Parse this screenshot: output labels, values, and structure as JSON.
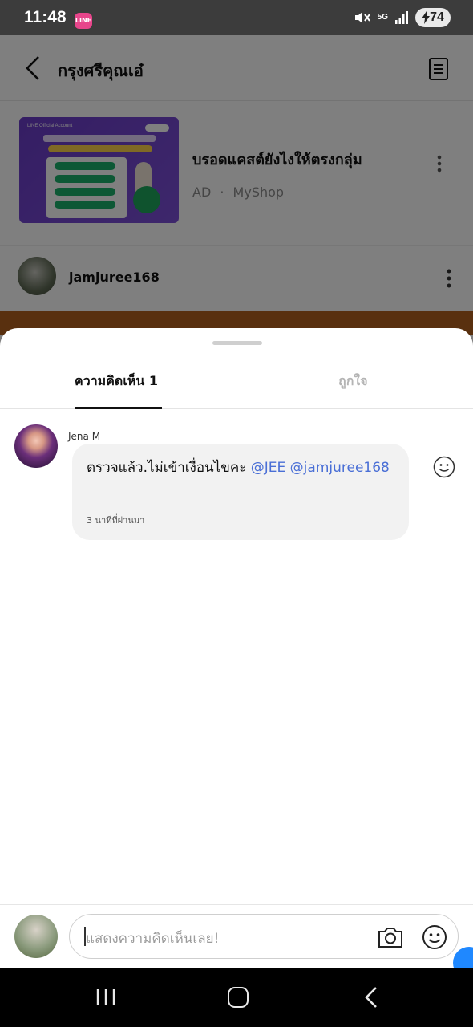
{
  "status_bar": {
    "time": "11:48",
    "app_icon_label": "LINE",
    "network": "5G",
    "battery": "74"
  },
  "header": {
    "title": "กรุงศรีคุณเอ๋"
  },
  "ad": {
    "title": "บรอดแคสต์ยังไงให้ตรงกลุ่ม",
    "tag": "AD",
    "separator": "·",
    "advertiser": "MyShop",
    "thumbnail_brand": "LINE Official Account"
  },
  "post": {
    "username": "jamjuree168"
  },
  "sheet": {
    "tabs": [
      {
        "label": "ความคิดเห็น 1",
        "active": true
      },
      {
        "label": "ถูกใจ",
        "active": false
      }
    ],
    "comments": [
      {
        "author": "Jena M",
        "text": "ตรวจแล้ว.ไม่เข้าเงื่อนไขคะ",
        "mentions": [
          "@JEE",
          "@jamjuree168"
        ],
        "time": "3 นาทีที่ผ่านมา"
      }
    ]
  },
  "composer": {
    "placeholder": "แสดงความคิดเห็นเลย!"
  },
  "icons": {
    "back": "back-arrow-icon",
    "note": "note-icon",
    "more": "more-vertical-icon",
    "react": "smiley-icon",
    "camera": "camera-icon",
    "emoji": "emoji-icon"
  },
  "colors": {
    "mention": "#4a6fd6",
    "active_tab": "#111111",
    "inactive_tab": "#b4b4b4",
    "status_bar": "#3c3c3c"
  }
}
